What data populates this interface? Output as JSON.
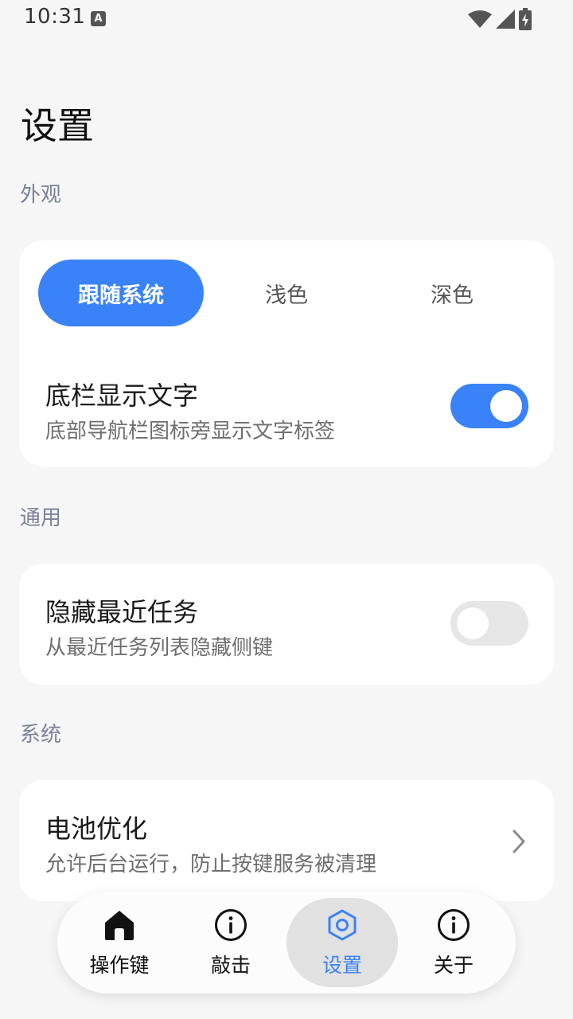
{
  "status": {
    "time": "10:31",
    "badge": "A"
  },
  "page": {
    "title": "设置"
  },
  "sections": {
    "appearance": "外观",
    "general": "通用",
    "system": "系统"
  },
  "theme": {
    "options": [
      "跟随系统",
      "浅色",
      "深色"
    ],
    "selected": "跟随系统"
  },
  "bottom_text": {
    "title": "底栏显示文字",
    "subtitle": "底部导航栏图标旁显示文字标签",
    "enabled": true
  },
  "hide_recents": {
    "title": "隐藏最近任务",
    "subtitle": "从最近任务列表隐藏侧键",
    "enabled": false
  },
  "battery": {
    "title": "电池优化",
    "subtitle": "允许后台运行，防止按键服务被清理",
    "icon": "chevron-right-icon"
  },
  "nav": {
    "items": [
      {
        "label": "操作键",
        "icon": "home-icon"
      },
      {
        "label": "敲击",
        "icon": "info-icon"
      },
      {
        "label": "设置",
        "icon": "settings-hexagon-icon"
      },
      {
        "label": "关于",
        "icon": "info-icon"
      }
    ],
    "active": "设置"
  },
  "colors": {
    "accent": "#3a82f7",
    "background": "#f6f6f6",
    "section_label": "#7a819b"
  }
}
